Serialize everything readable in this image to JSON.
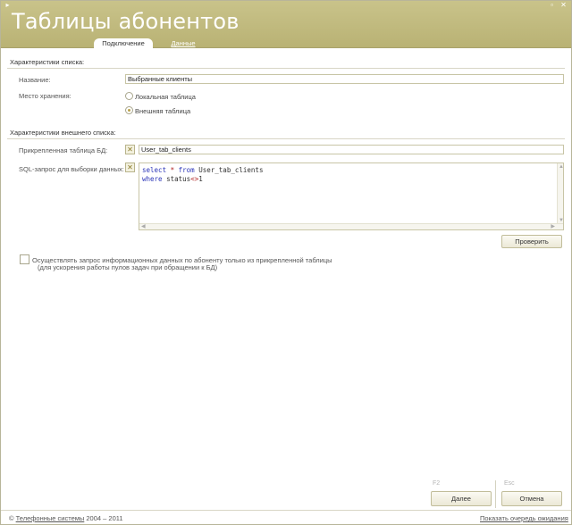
{
  "window": {
    "title": "Таблицы абонентов",
    "controls": {
      "menu": "▸",
      "minimize": "▫",
      "close": "✕"
    }
  },
  "tabs": [
    {
      "label": "Подключение",
      "active": true
    },
    {
      "label": "Данные",
      "active": false
    }
  ],
  "list_section": {
    "title": "Характеристики списка:",
    "name_label": "Название:",
    "name_value": "Выбранные клиенты",
    "storage_label": "Место хранения:",
    "storage_options": [
      {
        "label": "Локальная таблица",
        "checked": false
      },
      {
        "label": "Внешняя таблица",
        "checked": true
      }
    ]
  },
  "external_section": {
    "title": "Характеристики внешнего списка:",
    "table_label": "Прикрепленная таблица БД:",
    "table_value": "User_tab_clients",
    "sql_label": "SQL-запрос для выборки данных:",
    "sql": {
      "line1_kw1": "select",
      "line1_op": "*",
      "line1_kw2": "from",
      "line1_rest": "User_tab_clients",
      "line2_kw": "where",
      "line2_field": "status",
      "line2_op": "<>",
      "line2_val": "1"
    },
    "clear_icon": "✕",
    "verify_button": "Проверить"
  },
  "option": {
    "checked": false,
    "label_line1": "Осуществлять запрос информационных данных по абоненту только из прикрепленной таблицы",
    "label_line2": "(для ускорения работы пулов задач при обращении к БД)"
  },
  "actions": {
    "next_hotkey": "F2",
    "next_label": "Далее",
    "cancel_hotkey": "Esc",
    "cancel_label": "Отмена"
  },
  "footer": {
    "copyright_symbol": "©",
    "company": "Телефонные системы",
    "years": "2004 – 2011",
    "queue_link": "Показать очередь ожидания"
  },
  "colors": {
    "header": "#c0b97e",
    "accent": "#b9a24a"
  }
}
